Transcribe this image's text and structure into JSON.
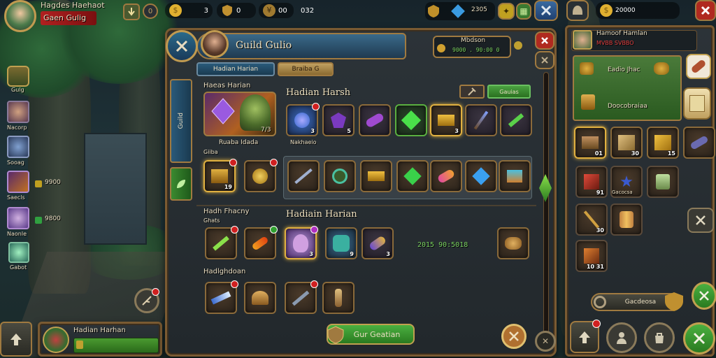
{
  "player": {
    "name": "Hagdes Haehaot",
    "guild": "Gaen Gulig"
  },
  "resources": {
    "gold": "3",
    "shield": "0",
    "coin": "00",
    "misc": "032",
    "gems_shield_amount": "2305"
  },
  "left_sidebar": {
    "items": [
      {
        "label": "Gulg"
      },
      {
        "label": "Nacorp"
      },
      {
        "label": "Sooag"
      },
      {
        "label": "Saecls",
        "reward": "9900"
      },
      {
        "label": "Naonle",
        "reward": "9800"
      },
      {
        "label": "Gabot"
      }
    ]
  },
  "bottom_left": {
    "title": "Hadian Harhan"
  },
  "dialog": {
    "title": "Guild Gulio",
    "status": "Mbdson",
    "status_value": "9000 . 90:00 0",
    "tabs": [
      {
        "label": "Hadian Harian"
      },
      {
        "label": "Braiba G"
      }
    ],
    "side_tab_label": "Guild",
    "section1": {
      "header": "Haeas Harian",
      "title": "Hadian Harsh",
      "featured_caption": "Ruaba Idada",
      "featured_count": "7/3",
      "sub_label": "Giiba",
      "item_caption": "Nakhaeio",
      "action_button": "Gauias",
      "quantities": [
        "3",
        "5",
        "",
        "",
        "3"
      ],
      "selected_quantities": [
        "19"
      ]
    },
    "section2": {
      "header": "Hadh Fhacny",
      "sub_label": "Ghats",
      "title": "Hadiain Harian",
      "timer": "2015 90:5018",
      "quantities": [
        "3",
        "9",
        "3"
      ]
    },
    "section3": {
      "header": "Hadlghdoan"
    },
    "primary_button": "Gur Geatian"
  },
  "right_panel": {
    "header_name": "Hamoof Hamlan",
    "header_value": "20000",
    "header_sub": "MVBB SVBBO",
    "card": {
      "line1": "Eadio Jhac",
      "line2": "Doocobraiaa"
    },
    "quantities": [
      "01",
      "30",
      "15",
      "91",
      "10 31"
    ],
    "extra_quantities": [
      "30",
      "91"
    ],
    "item_label": "Gacocsa",
    "bottom_button": "Gacdeosa"
  },
  "colors": {
    "accent_gold": "#a07a40",
    "button_green": "#3aa040",
    "badge_red": "#d02020"
  }
}
